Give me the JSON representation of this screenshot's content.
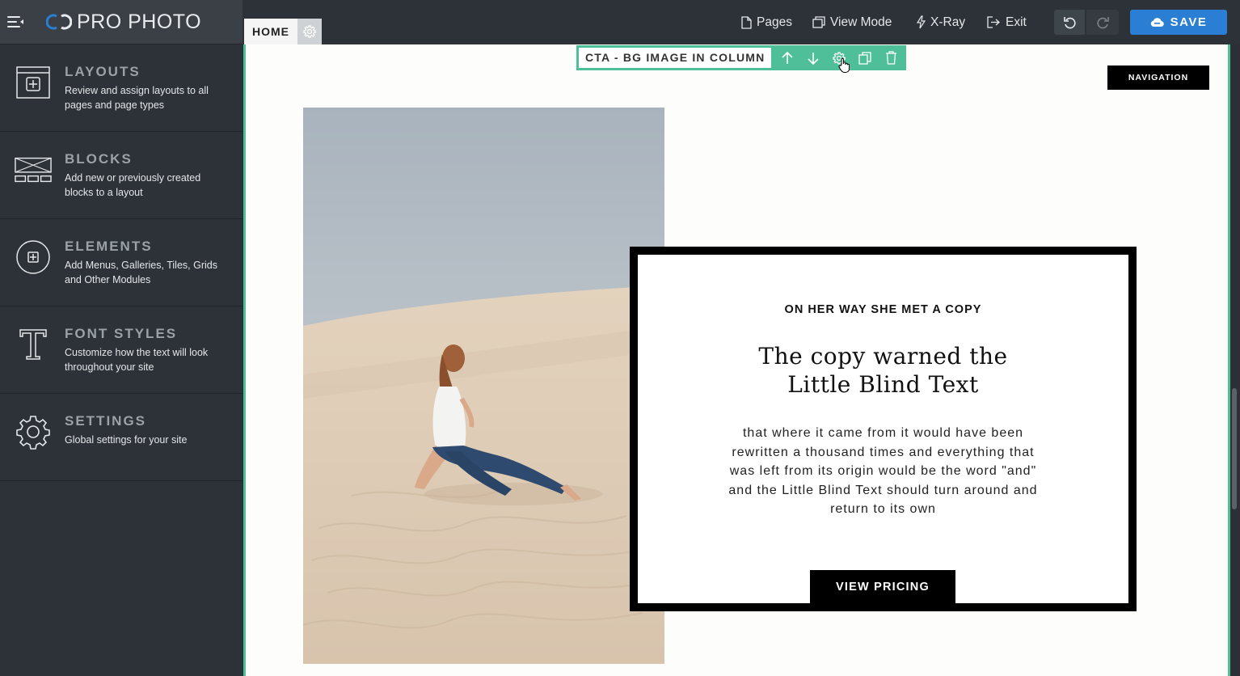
{
  "app": {
    "logo_text": "PRO PHOTO"
  },
  "sidebar": {
    "items": [
      {
        "title": "LAYOUTS",
        "desc": "Review and assign layouts to all pages and page types",
        "icon": "layout-add-icon"
      },
      {
        "title": "BLOCKS",
        "desc": "Add new or previously created blocks to a layout",
        "icon": "blocks-icon"
      },
      {
        "title": "ELEMENTS",
        "desc": "Add Menus, Galleries, Tiles, Grids and Other Modules",
        "icon": "plus-circle-icon"
      },
      {
        "title": "FONT STYLES",
        "desc": "Customize how the text will look throughout your site",
        "icon": "font-t-icon"
      },
      {
        "title": "SETTINGS",
        "desc": "Global settings for your site",
        "icon": "gear-icon"
      }
    ]
  },
  "topbar": {
    "page_tab": "HOME",
    "links": {
      "pages": "Pages",
      "view_mode": "View Mode",
      "xray": "X-Ray",
      "exit": "Exit"
    },
    "save_label": "SAVE"
  },
  "canvas": {
    "block_label": "CTA - BG IMAGE IN COLUMN",
    "nav_button": "NAVIGATION",
    "cta": {
      "kicker": "ON HER WAY SHE MET A COPY",
      "heading": "The copy warned the Little Blind Text",
      "body": "that where it came from it would have been rewritten a thousand times and everything that was left from its origin would be the word \"and\" and the Little Blind Text should turn around and return to its own",
      "button": "VIEW PRICING"
    }
  },
  "colors": {
    "accent": "#4fbf9a",
    "save": "#2a7fd4",
    "sidebar_bg": "#2c3237"
  }
}
